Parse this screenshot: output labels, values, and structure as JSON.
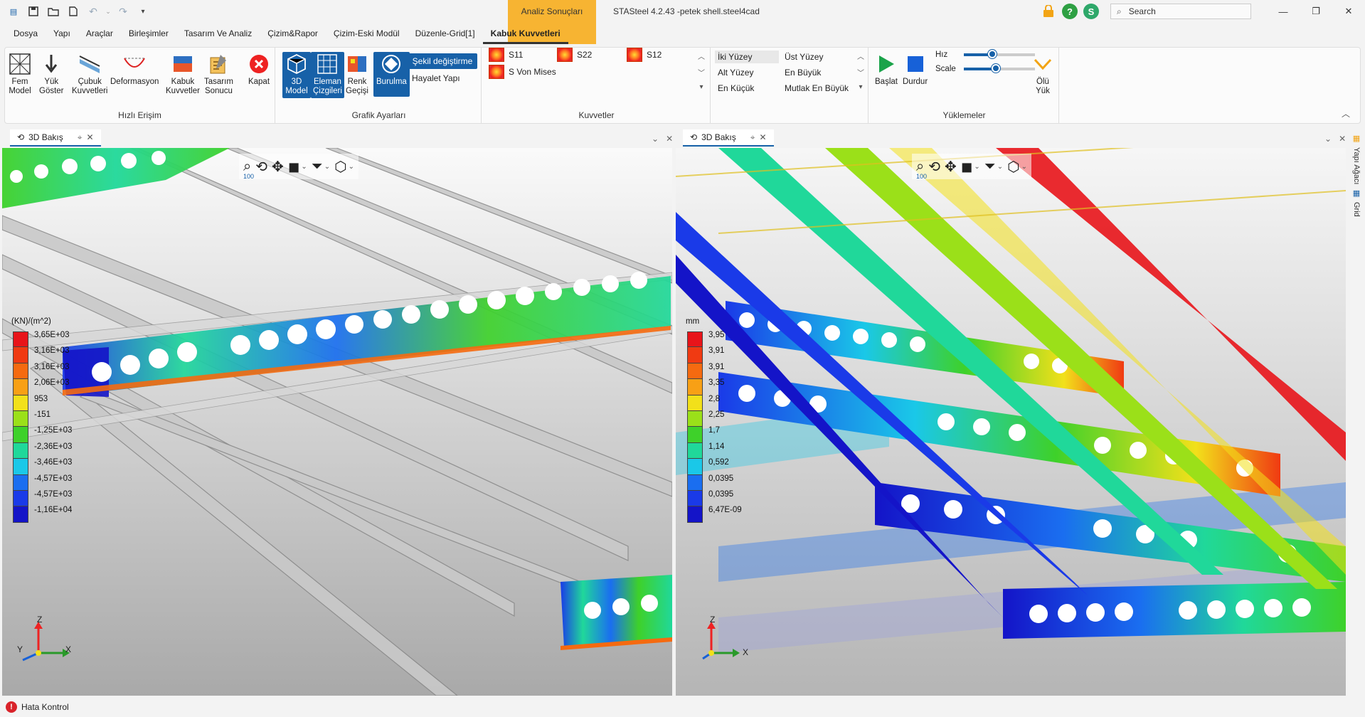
{
  "window": {
    "title": "STASteel 4.2.43 -petek shell.steel4cad",
    "context_tab": "Analiz Sonuçları",
    "search_placeholder": "Search",
    "user_initial": "S"
  },
  "menu": [
    {
      "label": "Dosya",
      "active": false
    },
    {
      "label": "Yapı",
      "active": false
    },
    {
      "label": "Araçlar",
      "active": false
    },
    {
      "label": "Birleşimler",
      "active": false
    },
    {
      "label": "Tasarım Ve Analiz",
      "active": false
    },
    {
      "label": "Çizim&Rapor",
      "active": false
    },
    {
      "label": "Çizim-Eski Modül",
      "active": false
    },
    {
      "label": "Düzenle-Grid[1]",
      "active": false
    },
    {
      "label": "Kabuk Kuvvetleri",
      "active": true
    }
  ],
  "ribbon": {
    "hizli_erisim": {
      "label": "Hızlı Erişim",
      "buttons": [
        {
          "l1": "Fem",
          "l2": "Model"
        },
        {
          "l1": "Yük",
          "l2": "Göster"
        },
        {
          "l1": "Çubuk",
          "l2": "Kuvvetleri"
        },
        {
          "l1": "Deformasyon",
          "l2": ""
        },
        {
          "l1": "Kabuk",
          "l2": "Kuvvetler"
        },
        {
          "l1": "Tasarım",
          "l2": "Sonucu"
        },
        {
          "l1": "Kapat",
          "l2": ""
        }
      ]
    },
    "grafik_ayarlari": {
      "label": "Grafik Ayarları",
      "buttons": [
        {
          "l1": "3D",
          "l2": "Model"
        },
        {
          "l1": "Eleman",
          "l2": "Çizgileri"
        },
        {
          "l1": "Renk",
          "l2": "Geçişi"
        },
        {
          "l1": "Burulma",
          "l2": ""
        }
      ],
      "sekil": "Şekil değiştirme",
      "hayalet": "Hayalet Yapı"
    },
    "kuvvetler": {
      "label": "Kuvvetler",
      "items": [
        "S11",
        "S22",
        "S12",
        "S Von Mises"
      ]
    },
    "surface": {
      "items": [
        "İki Yüzey",
        "Üst Yüzey",
        "Alt Yüzey",
        "En Büyük",
        "En Küçük",
        "Mutlak En Büyük"
      ]
    },
    "yuklemeler": {
      "label": "Yüklemeler",
      "baslat": "Başlat",
      "durdur": "Durdur",
      "hiz": "Hız",
      "scale": "Scale",
      "hiz_level": 0.4,
      "scale_level": 0.45,
      "olu_l1": "Ölü",
      "olu_l2": "Yük"
    }
  },
  "panels": {
    "left": {
      "tab": "3D Bakış",
      "zoom": "100",
      "legend": {
        "unit": "(KN)/(m^2)",
        "values": [
          "3,65E+03",
          "3,16E+03",
          "3,16E+03",
          "2,06E+03",
          "953",
          "-151",
          "-1,25E+03",
          "-2,36E+03",
          "-3,46E+03",
          "-4,57E+03",
          "-4,57E+03",
          "-1,16E+04"
        ]
      }
    },
    "right": {
      "tab": "3D Bakış",
      "zoom": "100",
      "legend": {
        "unit": "mm",
        "values": [
          "3,95",
          "3,91",
          "3,91",
          "3,35",
          "2,8",
          "2,25",
          "1,7",
          "1,14",
          "0,592",
          "0,0395",
          "0,0395",
          "6,47E-09"
        ]
      }
    }
  },
  "legend_colors": [
    "#e8141a",
    "#f03a12",
    "#f56a10",
    "#f8a015",
    "#f2e01a",
    "#9be019",
    "#3ed12a",
    "#20d89a",
    "#1ac8e8",
    "#1a6ef0",
    "#1a3ae8",
    "#1414c8"
  ],
  "axes": {
    "x": "X",
    "y": "Y",
    "z": "Z"
  },
  "sidebar_right": [
    "Yapı Ağacı",
    "Grid"
  ],
  "status": {
    "label": "Hata Kontrol"
  }
}
